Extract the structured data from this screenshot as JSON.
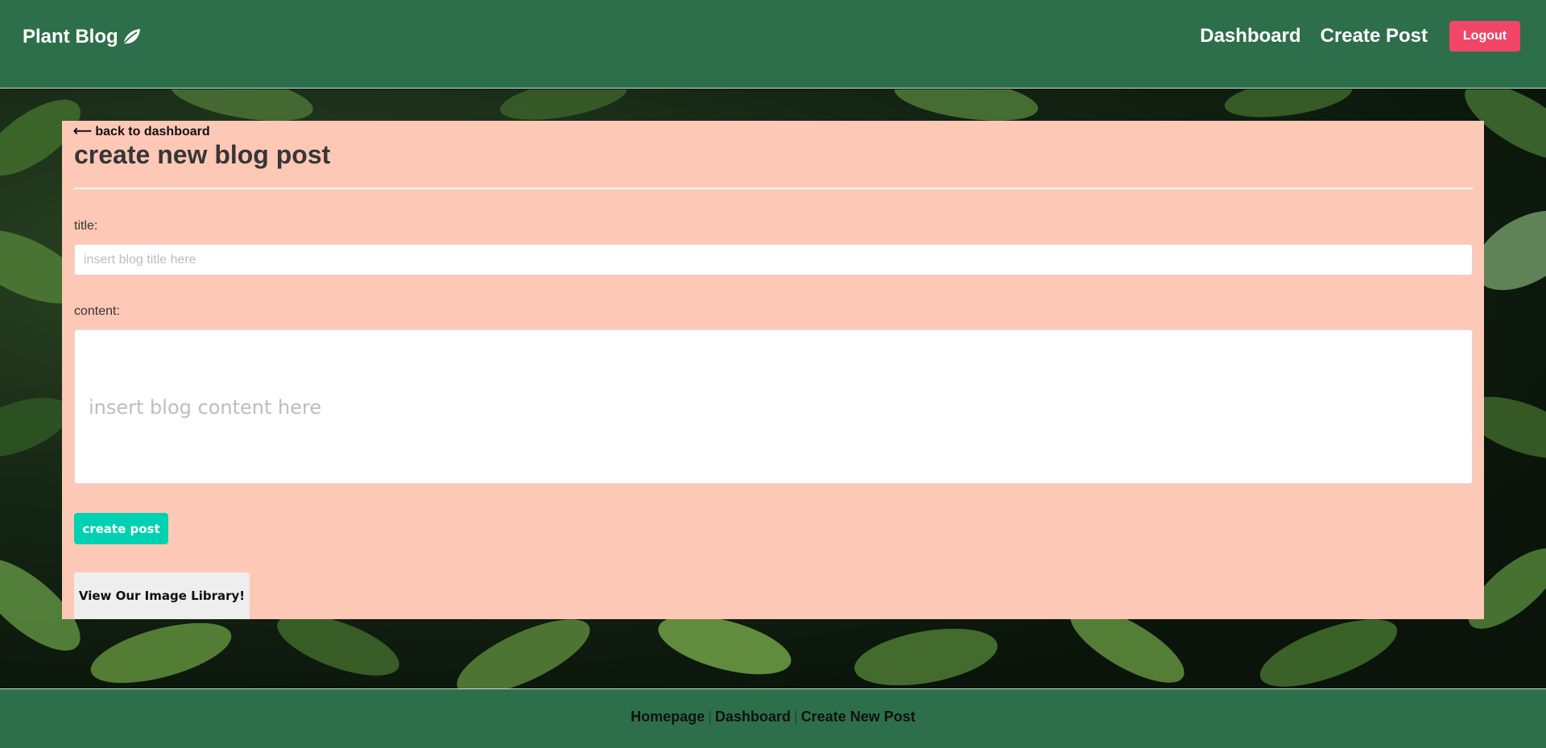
{
  "header": {
    "brand": "Plant Blog",
    "nav": {
      "dashboard": "Dashboard",
      "create_post": "Create Post",
      "logout": "Logout"
    }
  },
  "form": {
    "back_link": "⟵ back to dashboard",
    "page_title": "create new blog post",
    "title_label": "title:",
    "title_placeholder": "insert blog title here",
    "content_label": "content:",
    "content_placeholder": "insert blog content here",
    "submit_label": "create post",
    "library_label": "View Our Image Library!"
  },
  "footer": {
    "links": [
      "Homepage",
      "Dashboard",
      "Create New Post"
    ],
    "separator": "|"
  },
  "colors": {
    "header_bg": "#2e6f4b",
    "card_bg": "#fec8b7",
    "logout_bg": "#f14668",
    "primary_button": "#00d1b2"
  },
  "icons": {
    "brand": "leaf-icon"
  }
}
